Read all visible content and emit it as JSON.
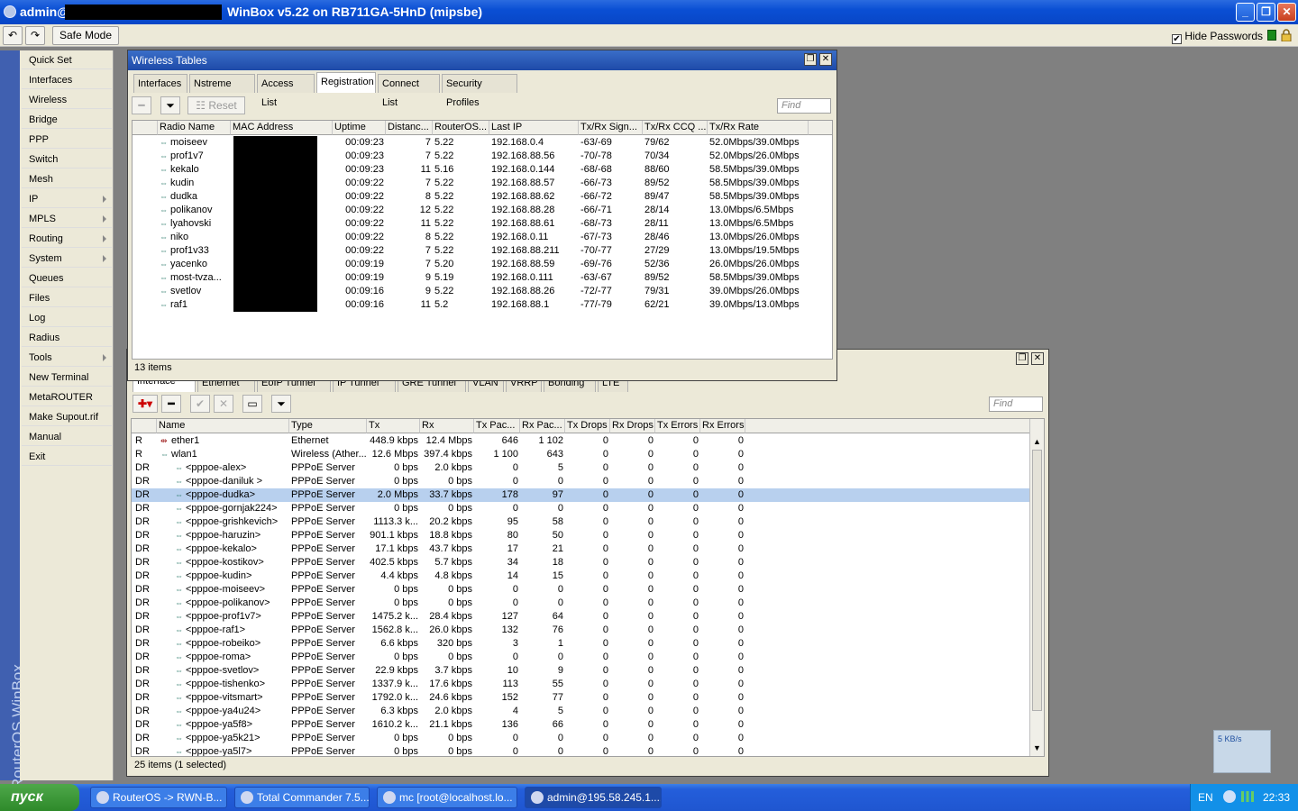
{
  "titlebar": {
    "user": "admin@",
    "title": "WinBox v5.22 on RB711GA-5HnD (mipsbe)",
    "minimize": "_",
    "restore": "❐",
    "close": "✕"
  },
  "toolbar": {
    "undo": "↶",
    "redo": "↷",
    "safe_mode": "Safe Mode",
    "hide_passwords": "Hide Passwords",
    "hide_passwords_checked": "✔"
  },
  "side_label": "RouterOS WinBox",
  "menu": [
    {
      "label": "Quick Set",
      "sub": false
    },
    {
      "label": "Interfaces",
      "sub": false
    },
    {
      "label": "Wireless",
      "sub": false
    },
    {
      "label": "Bridge",
      "sub": false
    },
    {
      "label": "PPP",
      "sub": false
    },
    {
      "label": "Switch",
      "sub": false
    },
    {
      "label": "Mesh",
      "sub": false
    },
    {
      "label": "IP",
      "sub": true
    },
    {
      "label": "MPLS",
      "sub": true
    },
    {
      "label": "Routing",
      "sub": true
    },
    {
      "label": "System",
      "sub": true
    },
    {
      "label": "Queues",
      "sub": false
    },
    {
      "label": "Files",
      "sub": false
    },
    {
      "label": "Log",
      "sub": false
    },
    {
      "label": "Radius",
      "sub": false
    },
    {
      "label": "Tools",
      "sub": true
    },
    {
      "label": "New Terminal",
      "sub": false
    },
    {
      "label": "MetaROUTER",
      "sub": false
    },
    {
      "label": "Make Supout.rif",
      "sub": false
    },
    {
      "label": "Manual",
      "sub": false
    },
    {
      "label": "Exit",
      "sub": false
    }
  ],
  "wireless": {
    "title": "Wireless Tables",
    "tabs": [
      "Interfaces",
      "Nstreme Dual",
      "Access List",
      "Registration",
      "Connect List",
      "Security Profiles"
    ],
    "active_tab": 3,
    "reset_label": "Reset",
    "find_placeholder": "Find",
    "columns": [
      "Radio Name",
      "MAC Address",
      "Uptime",
      "Distanc...",
      "RouterOS...",
      "Last IP",
      "Tx/Rx Sign...",
      "Tx/Rx CCQ ...",
      "Tx/Rx Rate"
    ],
    "rows": [
      [
        "moiseev",
        "00:09:23",
        "7",
        "5.22",
        "192.168.0.4",
        "-63/-69",
        "79/62",
        "52.0Mbps/39.0Mbps"
      ],
      [
        "prof1v7",
        "00:09:23",
        "7",
        "5.22",
        "192.168.88.56",
        "-70/-78",
        "70/34",
        "52.0Mbps/26.0Mbps"
      ],
      [
        "kekalo",
        "00:09:23",
        "11",
        "5.16",
        "192.168.0.144",
        "-68/-68",
        "88/60",
        "58.5Mbps/39.0Mbps"
      ],
      [
        "kudin",
        "00:09:22",
        "7",
        "5.22",
        "192.168.88.57",
        "-66/-73",
        "89/52",
        "58.5Mbps/39.0Mbps"
      ],
      [
        "dudka",
        "00:09:22",
        "8",
        "5.22",
        "192.168.88.62",
        "-66/-72",
        "89/47",
        "58.5Mbps/39.0Mbps"
      ],
      [
        "polikanov",
        "00:09:22",
        "12",
        "5.22",
        "192.168.88.28",
        "-66/-71",
        "28/14",
        "13.0Mbps/6.5Mbps"
      ],
      [
        "lyahovski",
        "00:09:22",
        "11",
        "5.22",
        "192.168.88.61",
        "-68/-73",
        "28/11",
        "13.0Mbps/6.5Mbps"
      ],
      [
        "niko",
        "00:09:22",
        "8",
        "5.22",
        "192.168.0.11",
        "-67/-73",
        "28/46",
        "13.0Mbps/26.0Mbps"
      ],
      [
        "prof1v33",
        "00:09:22",
        "7",
        "5.22",
        "192.168.88.211",
        "-70/-77",
        "27/29",
        "13.0Mbps/19.5Mbps"
      ],
      [
        "yacenko",
        "00:09:19",
        "7",
        "5.20",
        "192.168.88.59",
        "-69/-76",
        "52/36",
        "26.0Mbps/26.0Mbps"
      ],
      [
        "most-tvza...",
        "00:09:19",
        "9",
        "5.19",
        "192.168.0.111",
        "-63/-67",
        "89/52",
        "58.5Mbps/39.0Mbps"
      ],
      [
        "svetlov",
        "00:09:16",
        "9",
        "5.22",
        "192.168.88.26",
        "-72/-77",
        "79/31",
        "39.0Mbps/26.0Mbps"
      ],
      [
        "raf1",
        "00:09:16",
        "11",
        "5.2",
        "192.168.88.1",
        "-77/-79",
        "62/21",
        "39.0Mbps/13.0Mbps"
      ]
    ],
    "count": "13 items"
  },
  "interfaces": {
    "tabs_hidden": [
      "Interface",
      "Ethernet",
      "EoIP Tunnel",
      "IP Tunnel",
      "GRE Tunnel",
      "VLAN",
      "VRRP",
      "Bonding",
      "LTE"
    ],
    "find_placeholder": "Find",
    "columns": [
      "Name",
      "Type",
      "Tx",
      "Rx",
      "Tx Pac...",
      "Rx Pac...",
      "Tx Drops",
      "Rx Drops",
      "Tx Errors",
      "Rx Errors"
    ],
    "rows": [
      [
        "R",
        "ether1",
        "Ethernet",
        "448.9 kbps",
        "12.4 Mbps",
        "646",
        "1 102",
        "0",
        "0",
        "0",
        "0"
      ],
      [
        "R",
        "wlan1",
        "Wireless (Ather...",
        "12.6 Mbps",
        "397.4 kbps",
        "1 100",
        "643",
        "0",
        "0",
        "0",
        "0"
      ],
      [
        "DR",
        "<pppoe-alex>",
        "PPPoE Server",
        "0 bps",
        "2.0 kbps",
        "0",
        "5",
        "0",
        "0",
        "0",
        "0"
      ],
      [
        "DR",
        "<pppoe-daniluk >",
        "PPPoE Server",
        "0 bps",
        "0 bps",
        "0",
        "0",
        "0",
        "0",
        "0",
        "0"
      ],
      [
        "DR",
        "<pppoe-dudka>",
        "PPPoE Server",
        "2.0 Mbps",
        "33.7 kbps",
        "178",
        "97",
        "0",
        "0",
        "0",
        "0"
      ],
      [
        "DR",
        "<pppoe-gornjak224>",
        "PPPoE Server",
        "0 bps",
        "0 bps",
        "0",
        "0",
        "0",
        "0",
        "0",
        "0"
      ],
      [
        "DR",
        "<pppoe-grishkevich>",
        "PPPoE Server",
        "1113.3 k...",
        "20.2 kbps",
        "95",
        "58",
        "0",
        "0",
        "0",
        "0"
      ],
      [
        "DR",
        "<pppoe-haruzin>",
        "PPPoE Server",
        "901.1 kbps",
        "18.8 kbps",
        "80",
        "50",
        "0",
        "0",
        "0",
        "0"
      ],
      [
        "DR",
        "<pppoe-kekalo>",
        "PPPoE Server",
        "17.1 kbps",
        "43.7 kbps",
        "17",
        "21",
        "0",
        "0",
        "0",
        "0"
      ],
      [
        "DR",
        "<pppoe-kostikov>",
        "PPPoE Server",
        "402.5 kbps",
        "5.7 kbps",
        "34",
        "18",
        "0",
        "0",
        "0",
        "0"
      ],
      [
        "DR",
        "<pppoe-kudin>",
        "PPPoE Server",
        "4.4 kbps",
        "4.8 kbps",
        "14",
        "15",
        "0",
        "0",
        "0",
        "0"
      ],
      [
        "DR",
        "<pppoe-moiseev>",
        "PPPoE Server",
        "0 bps",
        "0 bps",
        "0",
        "0",
        "0",
        "0",
        "0",
        "0"
      ],
      [
        "DR",
        "<pppoe-polikanov>",
        "PPPoE Server",
        "0 bps",
        "0 bps",
        "0",
        "0",
        "0",
        "0",
        "0",
        "0"
      ],
      [
        "DR",
        "<pppoe-prof1v7>",
        "PPPoE Server",
        "1475.2 k...",
        "28.4 kbps",
        "127",
        "64",
        "0",
        "0",
        "0",
        "0"
      ],
      [
        "DR",
        "<pppoe-raf1>",
        "PPPoE Server",
        "1562.8 k...",
        "26.0 kbps",
        "132",
        "76",
        "0",
        "0",
        "0",
        "0"
      ],
      [
        "DR",
        "<pppoe-robeiko>",
        "PPPoE Server",
        "6.6 kbps",
        "320 bps",
        "3",
        "1",
        "0",
        "0",
        "0",
        "0"
      ],
      [
        "DR",
        "<pppoe-roma>",
        "PPPoE Server",
        "0 bps",
        "0 bps",
        "0",
        "0",
        "0",
        "0",
        "0",
        "0"
      ],
      [
        "DR",
        "<pppoe-svetlov>",
        "PPPoE Server",
        "22.9 kbps",
        "3.7 kbps",
        "10",
        "9",
        "0",
        "0",
        "0",
        "0"
      ],
      [
        "DR",
        "<pppoe-tishenko>",
        "PPPoE Server",
        "1337.9 k...",
        "17.6 kbps",
        "113",
        "55",
        "0",
        "0",
        "0",
        "0"
      ],
      [
        "DR",
        "<pppoe-vitsmart>",
        "PPPoE Server",
        "1792.0 k...",
        "24.6 kbps",
        "152",
        "77",
        "0",
        "0",
        "0",
        "0"
      ],
      [
        "DR",
        "<pppoe-ya4u24>",
        "PPPoE Server",
        "6.3 kbps",
        "2.0 kbps",
        "4",
        "5",
        "0",
        "0",
        "0",
        "0"
      ],
      [
        "DR",
        "<pppoe-ya5f8>",
        "PPPoE Server",
        "1610.2 k...",
        "21.1 kbps",
        "136",
        "66",
        "0",
        "0",
        "0",
        "0"
      ],
      [
        "DR",
        "<pppoe-ya5k21>",
        "PPPoE Server",
        "0 bps",
        "0 bps",
        "0",
        "0",
        "0",
        "0",
        "0",
        "0"
      ],
      [
        "DR",
        "<pppoe-ya5l7>",
        "PPPoE Server",
        "0 bps",
        "0 bps",
        "0",
        "0",
        "0",
        "0",
        "0",
        "0"
      ]
    ],
    "selected_row": 4,
    "count": "25 items (1 selected)"
  },
  "taskbar": {
    "start": "пуск",
    "tasks": [
      "RouterOS -> RWN-B...",
      "Total Commander 7.5...",
      "mc [root@localhost.lo...",
      "admin@195.58.245.1...."
    ],
    "active_task": 3,
    "lang": "EN",
    "clock": "22:33"
  },
  "speed_widget": "5 KB/s",
  "colors": {
    "title_blue": "#0a4fd4",
    "selected_row": "#b8d0ee",
    "side_label": "#4060b0"
  }
}
